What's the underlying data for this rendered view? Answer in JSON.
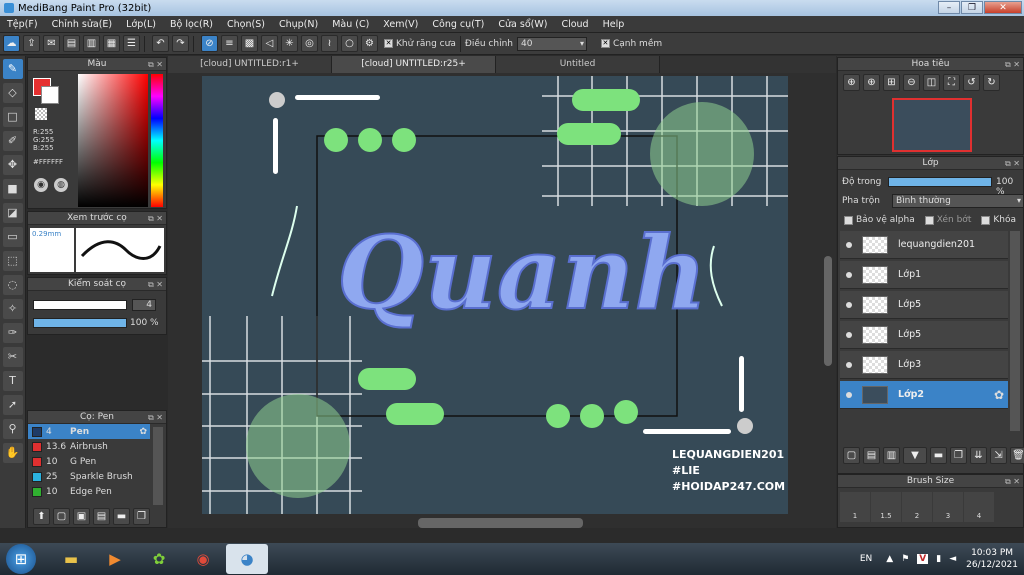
{
  "app": {
    "title": "MediBang Paint Pro (32bit)"
  },
  "menu": [
    "Tệp(F)",
    "Chỉnh sửa(E)",
    "Lớp(L)",
    "Bộ lọc(R)",
    "Chọn(S)",
    "Chụp(N)",
    "Màu (C)",
    "Xem(V)",
    "Công cụ(T)",
    "Cửa sổ(W)",
    "Cloud",
    "Help"
  ],
  "toolbar": {
    "antialias_label": "Khử răng cưa",
    "adjust_label": "Điều chỉnh",
    "adjust_value": "40",
    "sharp_label": "Cạnh mềm"
  },
  "color_panel": {
    "title": "Màu",
    "r": "R:255",
    "g": "G:255",
    "b": "B:255",
    "hex": "#FFFFFF"
  },
  "brush_preview": {
    "title": "Xem trước cọ",
    "size": "0.29mm"
  },
  "brush_control": {
    "title": "Kiểm soát cọ",
    "size_value": "4",
    "opacity_value": "100 %"
  },
  "brush_list": {
    "title": "Cọ: Pen",
    "items": [
      {
        "size": "4",
        "name": "Pen",
        "color": "#1f3b66"
      },
      {
        "size": "13.6",
        "name": "Airbrush",
        "color": "#e03030"
      },
      {
        "size": "10",
        "name": "G Pen",
        "color": "#e03030"
      },
      {
        "size": "25",
        "name": "Sparkle Brush",
        "color": "#2bb3e0"
      },
      {
        "size": "10",
        "name": "Edge Pen",
        "color": "#30b030"
      }
    ]
  },
  "tabs": [
    "[cloud] UNTITLED:r1+",
    "[cloud] UNTITLED:r25+",
    "Untitled"
  ],
  "artwork": {
    "main_text": "Quanh",
    "credit1": "LEQUANGDIEN201",
    "credit2": "#LIE",
    "credit3": "#HOIDAP247.COM"
  },
  "navigator": {
    "title": "Hoa tiêu"
  },
  "layers_panel": {
    "title": "Lớp",
    "opacity_label": "Độ trong",
    "opacity_value": "100 %",
    "blend_label": "Pha trộn",
    "blend_value": "Bình thường",
    "protect_alpha": "Bảo vệ alpha",
    "clip": "Xén bớt",
    "lock": "Khóa",
    "layers": [
      "lequangdien201",
      "Lớp1",
      "Lớp5",
      "Lớp5",
      "Lớp3",
      "Lớp2"
    ]
  },
  "brush_size": {
    "title": "Brush Size",
    "sizes": [
      "1",
      "1.5",
      "2",
      "3",
      "4"
    ]
  },
  "taskbar": {
    "lang": "EN",
    "time": "10:03 PM",
    "date": "26/12/2021"
  },
  "colors": {
    "accent": "#3b83c7",
    "canvas_bg": "#364a57"
  }
}
